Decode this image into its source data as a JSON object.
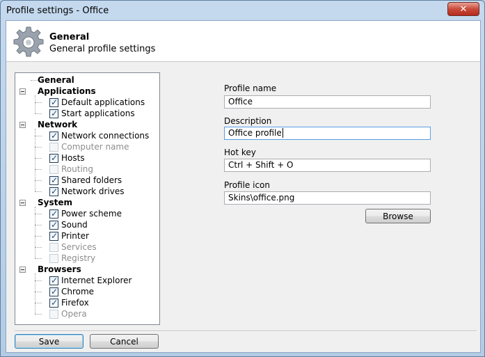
{
  "window": {
    "title": "Profile settings - Office"
  },
  "header": {
    "title": "General",
    "subtitle": "General profile settings"
  },
  "tree": [
    {
      "label": "General",
      "type": "group"
    },
    {
      "label": "Applications",
      "type": "group",
      "children": [
        {
          "label": "Default applications",
          "checked": true,
          "enabled": true
        },
        {
          "label": "Start applications",
          "checked": true,
          "enabled": true
        }
      ]
    },
    {
      "label": "Network",
      "type": "group",
      "children": [
        {
          "label": "Network connections",
          "checked": true,
          "enabled": true
        },
        {
          "label": "Computer name",
          "checked": false,
          "enabled": false
        },
        {
          "label": "Hosts",
          "checked": true,
          "enabled": true
        },
        {
          "label": "Routing",
          "checked": false,
          "enabled": false
        },
        {
          "label": "Shared folders",
          "checked": true,
          "enabled": true
        },
        {
          "label": "Network drives",
          "checked": true,
          "enabled": true
        }
      ]
    },
    {
      "label": "System",
      "type": "group",
      "children": [
        {
          "label": "Power scheme",
          "checked": true,
          "enabled": true
        },
        {
          "label": "Sound",
          "checked": true,
          "enabled": true
        },
        {
          "label": "Printer",
          "checked": true,
          "enabled": true
        },
        {
          "label": "Services",
          "checked": false,
          "enabled": false
        },
        {
          "label": "Registry",
          "checked": false,
          "enabled": false
        }
      ]
    },
    {
      "label": "Browsers",
      "type": "group",
      "children": [
        {
          "label": "Internet Explorer",
          "checked": true,
          "enabled": true
        },
        {
          "label": "Chrome",
          "checked": true,
          "enabled": true
        },
        {
          "label": "Firefox",
          "checked": true,
          "enabled": true
        },
        {
          "label": "Opera",
          "checked": false,
          "enabled": false
        }
      ]
    }
  ],
  "form": {
    "profile_name_label": "Profile name",
    "profile_name_value": "Office",
    "description_label": "Description",
    "description_value": "Office profile",
    "hotkey_label": "Hot key",
    "hotkey_value": "Ctrl + Shift + O",
    "icon_label": "Profile icon",
    "icon_value": "Skins\\office.png",
    "browse_label": "Browse"
  },
  "footer": {
    "save_label": "Save",
    "cancel_label": "Cancel"
  },
  "icons": {
    "header": "gear-icon",
    "close": "close-icon"
  },
  "colors": {
    "title_bar": "#c5d9ee",
    "close_button": "#c94a3a",
    "focus_border": "#569de5",
    "check": "#1d4c7a"
  }
}
